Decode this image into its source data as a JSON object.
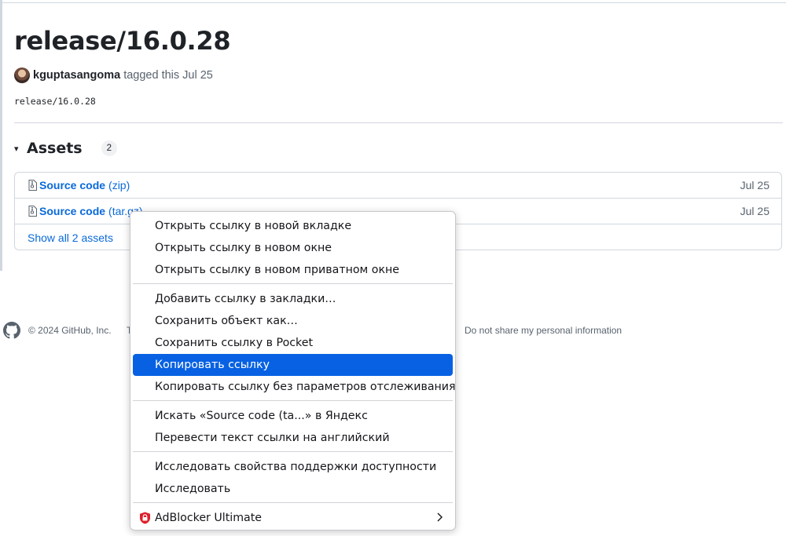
{
  "release": {
    "title": "release/16.0.28",
    "author": "kguptasangoma",
    "tagged_text": "tagged this Jul 25",
    "tag_name": "release/16.0.28"
  },
  "assets": {
    "caret": "▾",
    "title": "Assets",
    "count": "2",
    "rows": [
      {
        "name": "Source code",
        "ext": "(zip)",
        "date": "Jul 25"
      },
      {
        "name": "Source code",
        "ext": "(tar.gz)",
        "date": "Jul 25"
      }
    ],
    "show_all": "Show all 2 assets"
  },
  "footer": {
    "copyright": "© 2024 GitHub, Inc.",
    "partial": "T",
    "privacy": "Do not share my personal information"
  },
  "context_menu": {
    "groups": [
      [
        "Открыть ссылку в новой вкладке",
        "Открыть ссылку в новом окне",
        "Открыть ссылку в новом приватном окне"
      ],
      [
        "Добавить ссылку в закладки…",
        "Сохранить объект как…",
        "Сохранить ссылку в Pocket",
        "Копировать ссылку",
        "Копировать ссылку без параметров отслеживания"
      ],
      [
        "Искать «Source code (ta...» в Яндекс",
        "Перевести текст ссылки на английский"
      ],
      [
        "Исследовать свойства поддержки доступности",
        "Исследовать"
      ],
      [
        "AdBlocker Ultimate"
      ]
    ],
    "highlighted": "Копировать ссылку"
  },
  "colors": {
    "link": "#0969da",
    "menu_highlight": "#0761e2",
    "adblocker_red": "#e0202b"
  },
  "icons": [
    "file-zip-icon",
    "github-mark-icon",
    "adblocker-shield-icon",
    "submenu-chevron-icon"
  ]
}
